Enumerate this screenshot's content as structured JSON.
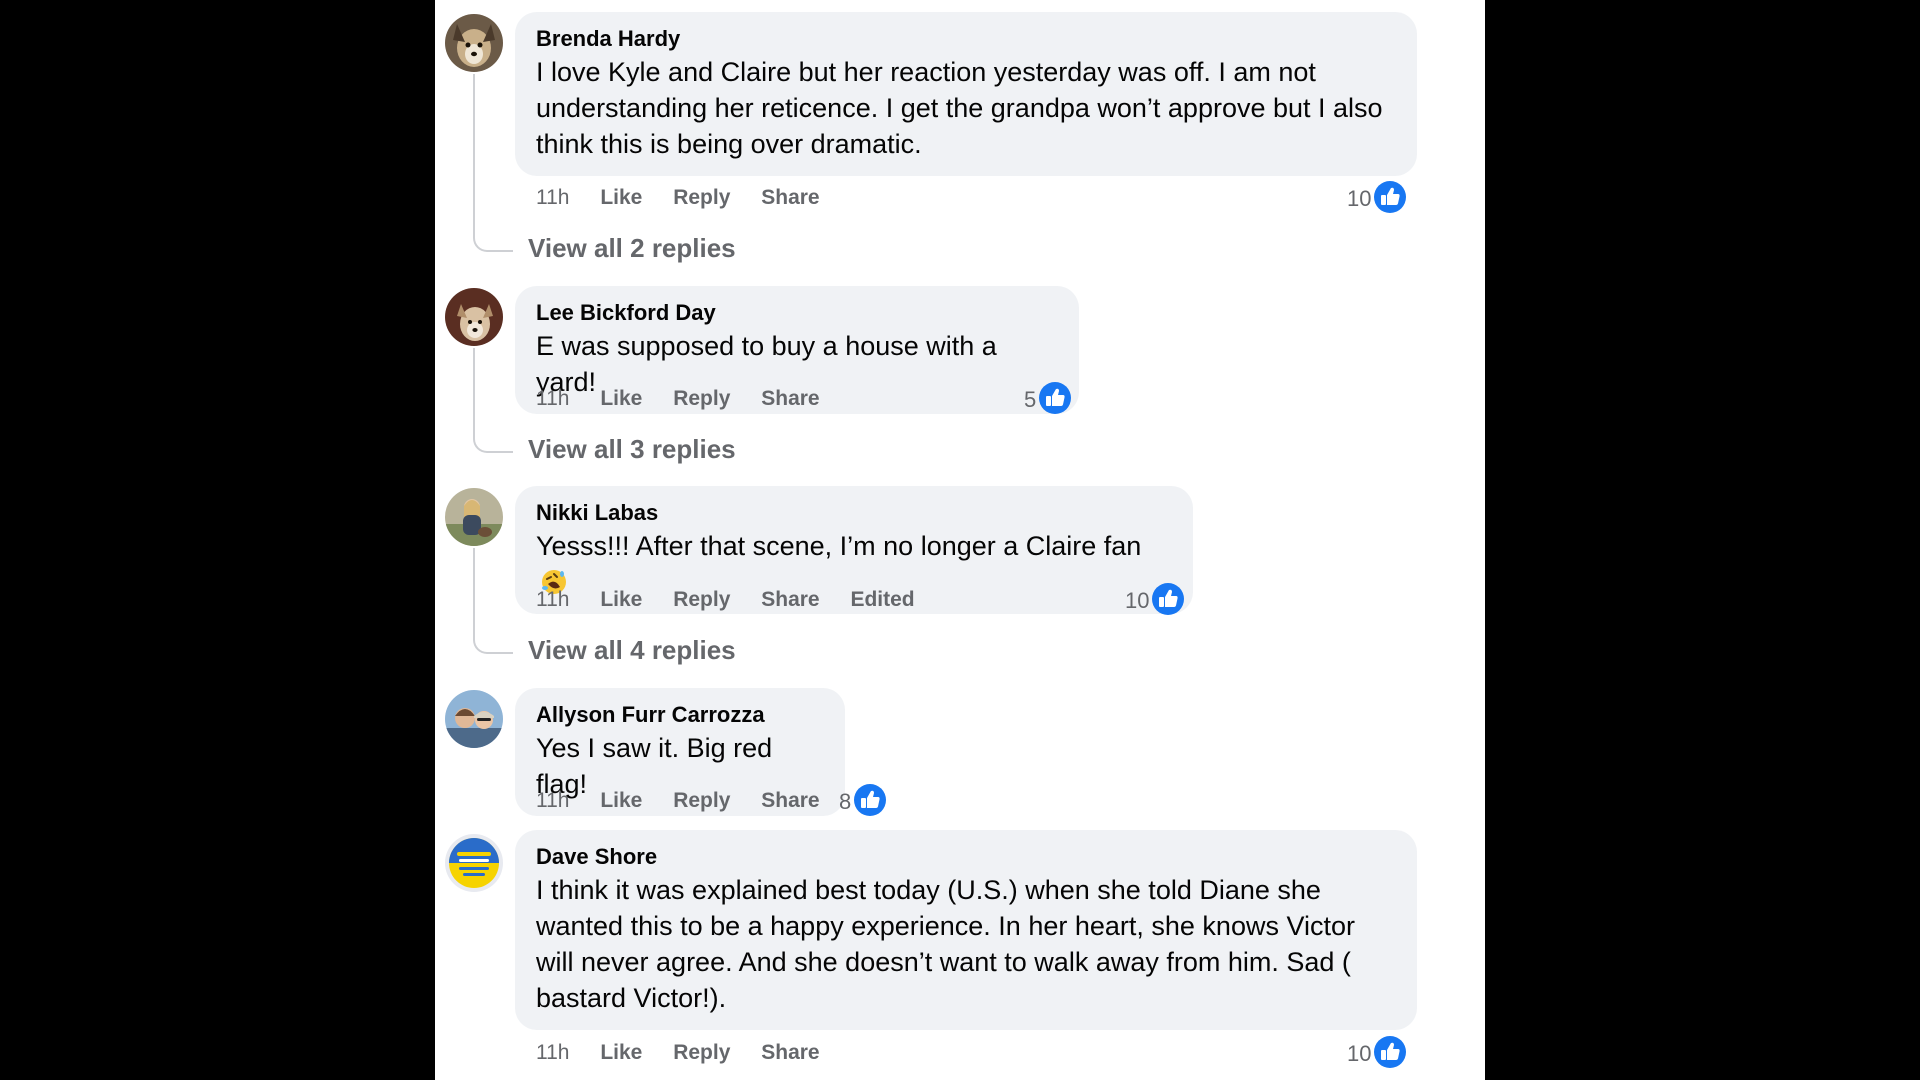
{
  "comments": [
    {
      "author": "Brenda Hardy",
      "lines": [
        "I love Kyle and Claire but her reaction yesterday was off. I am not",
        "understanding her reticence. I get the grandpa won’t approve but I also",
        "think this is being over dramatic."
      ],
      "time": "11h",
      "like_label": "Like",
      "reply_label": "Reply",
      "share_label": "Share",
      "reaction_count": "10",
      "view_replies": "View all 2 replies"
    },
    {
      "author": "Lee Bickford Day",
      "lines": [
        "E was supposed to buy a house with a yard!"
      ],
      "time": "11h",
      "like_label": "Like",
      "reply_label": "Reply",
      "share_label": "Share",
      "reaction_count": "5",
      "view_replies": "View all 3 replies"
    },
    {
      "author": "Nikki Labas",
      "lines": [
        "Yesss!!! After that scene, I’m no longer a Claire fan"
      ],
      "emoji": "rolling-on-floor-laughing",
      "time": "11h",
      "like_label": "Like",
      "reply_label": "Reply",
      "share_label": "Share",
      "edited_label": "Edited",
      "reaction_count": "10",
      "view_replies": "View all 4 replies"
    },
    {
      "author": "Allyson Furr Carrozza",
      "lines": [
        "Yes I saw it. Big red flag!"
      ],
      "time": "11h",
      "like_label": "Like",
      "reply_label": "Reply",
      "share_label": "Share",
      "reaction_count": "8"
    },
    {
      "author": "Dave Shore",
      "lines": [
        "I think it was explained best today (U.S.) when she told Diane she",
        "wanted this to be a happy experience. In her heart, she knows Victor",
        "will never agree. And she doesn’t want to walk away from him. Sad (",
        "bastard Victor!)."
      ],
      "time": "11h",
      "like_label": "Like",
      "reply_label": "Reply",
      "share_label": "Share",
      "reaction_count": "10"
    }
  ],
  "colors": {
    "bubble": "#f0f2f5",
    "secondary_text": "#65676b",
    "like_blue": "#1877f2",
    "thread_line": "#ced0d4"
  }
}
